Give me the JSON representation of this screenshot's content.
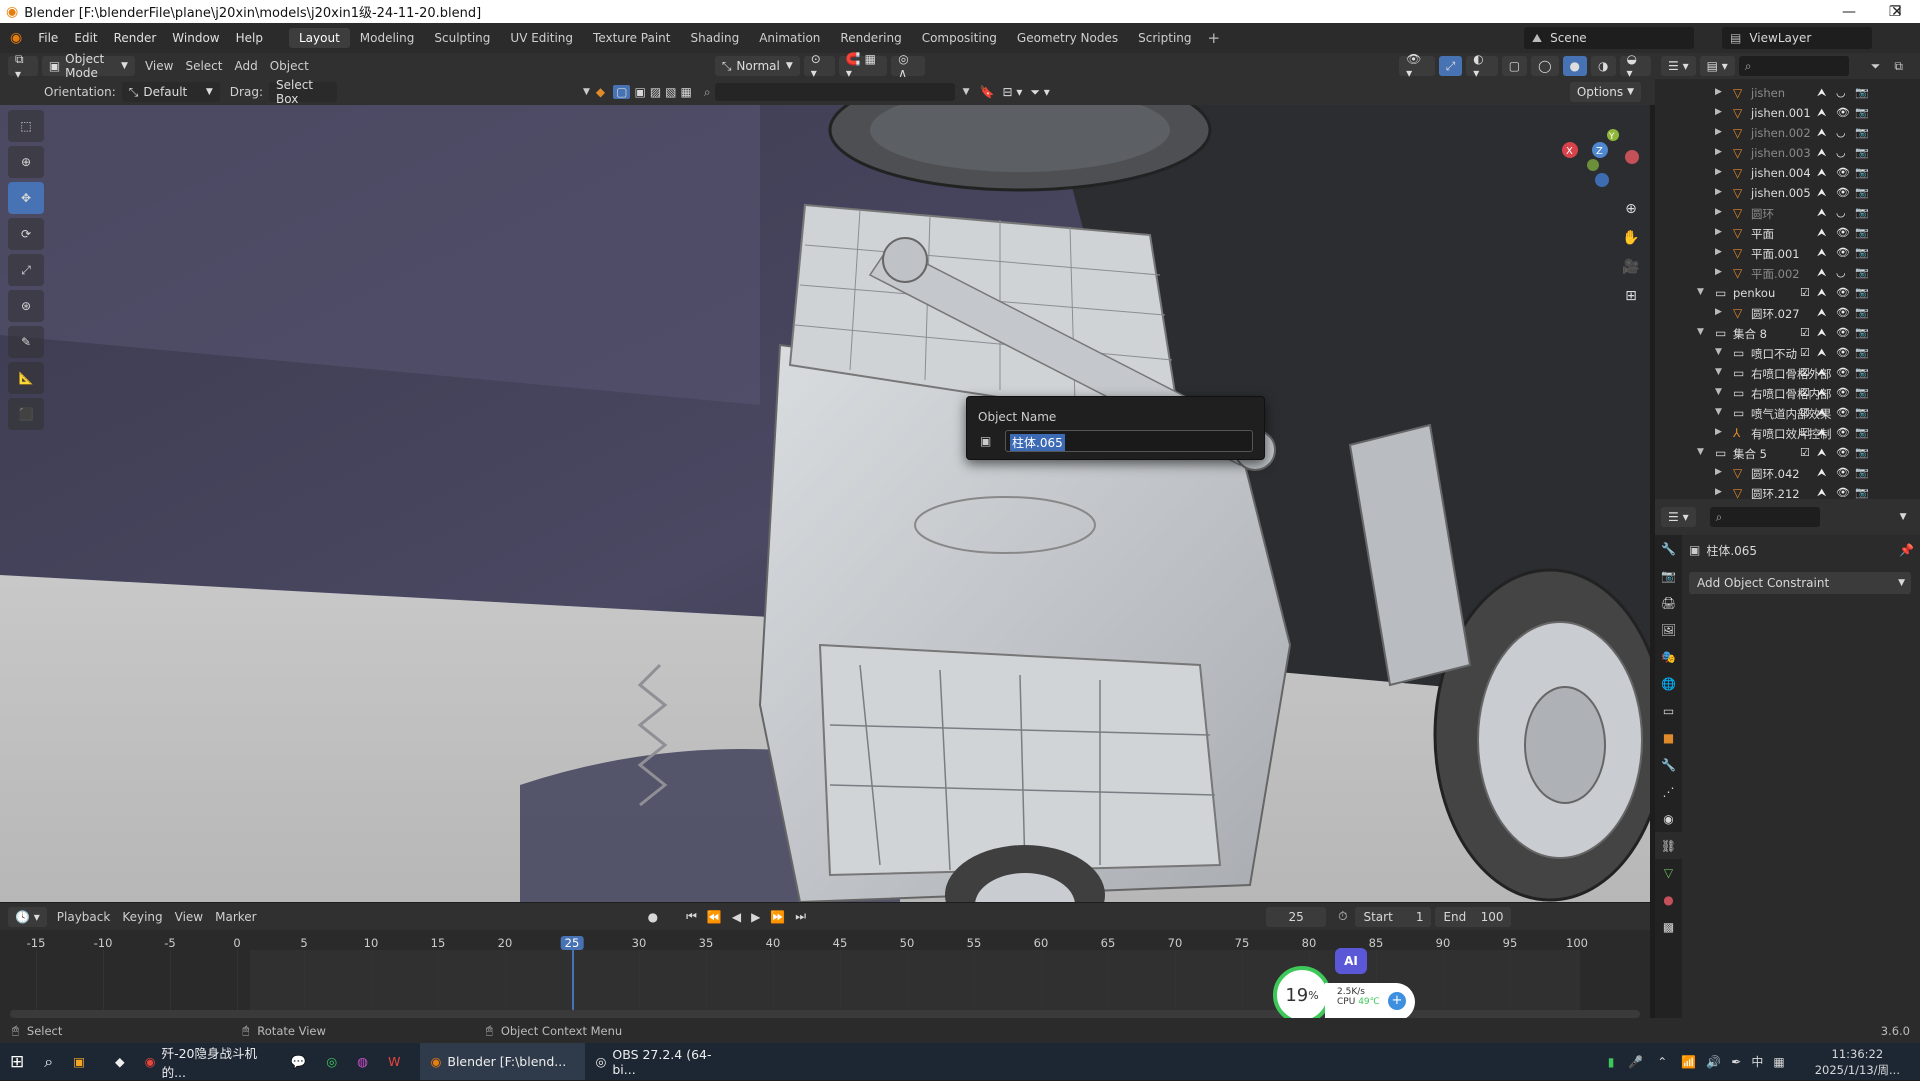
{
  "window": {
    "title": "Blender [F:\\blenderFile\\plane\\j20xin\\models\\j20xin1级-24-11-20.blend]"
  },
  "menubar": {
    "menus": [
      "File",
      "Edit",
      "Render",
      "Window",
      "Help"
    ],
    "tabs": [
      "Layout",
      "Modeling",
      "Sculpting",
      "UV Editing",
      "Texture Paint",
      "Shading",
      "Animation",
      "Rendering",
      "Compositing",
      "Geometry Nodes",
      "Scripting"
    ],
    "active_tab": "Layout",
    "scene": "Scene",
    "viewlayer": "ViewLayer"
  },
  "header": {
    "mode": "Object Mode",
    "menus": [
      "View",
      "Select",
      "Add",
      "Object"
    ],
    "transform_orientation": "Normal",
    "options": "Options"
  },
  "toolsettings": {
    "orientation_label": "Orientation:",
    "orientation_value": "Default",
    "drag_label": "Drag:",
    "drag_value": "Select Box"
  },
  "popup": {
    "label": "Object Name",
    "value": "柱体.065"
  },
  "outliner": {
    "rows": [
      {
        "name": "jishen",
        "indent": 2,
        "type": "mesh",
        "dim": true
      },
      {
        "name": "jishen.001",
        "indent": 2,
        "type": "mesh",
        "dim": false
      },
      {
        "name": "jishen.002",
        "indent": 2,
        "type": "mesh",
        "dim": true
      },
      {
        "name": "jishen.003",
        "indent": 2,
        "type": "mesh",
        "dim": true
      },
      {
        "name": "jishen.004",
        "indent": 2,
        "type": "mesh",
        "dim": false
      },
      {
        "name": "jishen.005",
        "indent": 2,
        "type": "mesh",
        "dim": false
      },
      {
        "name": "圆环",
        "indent": 2,
        "type": "mesh",
        "dim": true
      },
      {
        "name": "平面",
        "indent": 2,
        "type": "mesh",
        "dim": false
      },
      {
        "name": "平面.001",
        "indent": 2,
        "type": "mesh",
        "dim": false
      },
      {
        "name": "平面.002",
        "indent": 2,
        "type": "mesh",
        "dim": true
      },
      {
        "name": "penkou",
        "indent": 1,
        "type": "collection",
        "dim": false
      },
      {
        "name": "圆环.027",
        "indent": 2,
        "type": "mesh",
        "dim": false
      },
      {
        "name": "集合 8",
        "indent": 1,
        "type": "collection",
        "dim": false
      },
      {
        "name": "喷口不动",
        "indent": 2,
        "type": "collection",
        "dim": false
      },
      {
        "name": "右喷口骨格外部",
        "indent": 2,
        "type": "collection",
        "dim": false
      },
      {
        "name": "右喷口骨格内部",
        "indent": 2,
        "type": "collection",
        "dim": false
      },
      {
        "name": "喷气道内部效果",
        "indent": 2,
        "type": "collection",
        "dim": false
      },
      {
        "name": "有喷口效片控制",
        "indent": 2,
        "type": "armature",
        "dim": false
      },
      {
        "name": "集合 5",
        "indent": 1,
        "type": "collection",
        "dim": false
      },
      {
        "name": "圆环.042",
        "indent": 2,
        "type": "mesh",
        "dim": false
      },
      {
        "name": "圆环.212",
        "indent": 2,
        "type": "mesh",
        "dim": false
      }
    ]
  },
  "properties": {
    "object_name": "柱体.065",
    "add_constraint": "Add Object Constraint"
  },
  "timeline": {
    "menus": [
      "Playback",
      "Keying",
      "View",
      "Marker"
    ],
    "current_frame": "25",
    "start_label": "Start",
    "start": "1",
    "end_label": "End",
    "end": "100",
    "ticks": [
      "-15",
      "-10",
      "-5",
      "0",
      "5",
      "10",
      "15",
      "20",
      "25",
      "30",
      "35",
      "40",
      "45",
      "50",
      "55",
      "60",
      "65",
      "70",
      "75",
      "80",
      "85",
      "90",
      "95",
      "100"
    ],
    "current_tick": "25"
  },
  "statusbar": {
    "select": "Select",
    "rotate": "Rotate View",
    "context": "Object Context Menu",
    "version": "3.6.0"
  },
  "overlay_widget": {
    "percent": "19",
    "percent_sign": "%",
    "net": "2.5K/s",
    "cpu_label": "CPU",
    "cpu_temp": "49℃",
    "ai": "AI"
  },
  "taskbar": {
    "items": [
      "歼-20隐身战斗机的...",
      "Blender [F:\\blend...",
      "OBS 27.2.4 (64-bi..."
    ],
    "time": "11:36:22",
    "date": "2025/1/13/周...",
    "ime": "中"
  },
  "colors": {
    "accent": "#4772b3",
    "selection": "#3d6ab5",
    "mesh_icon": "#e08a2c"
  }
}
